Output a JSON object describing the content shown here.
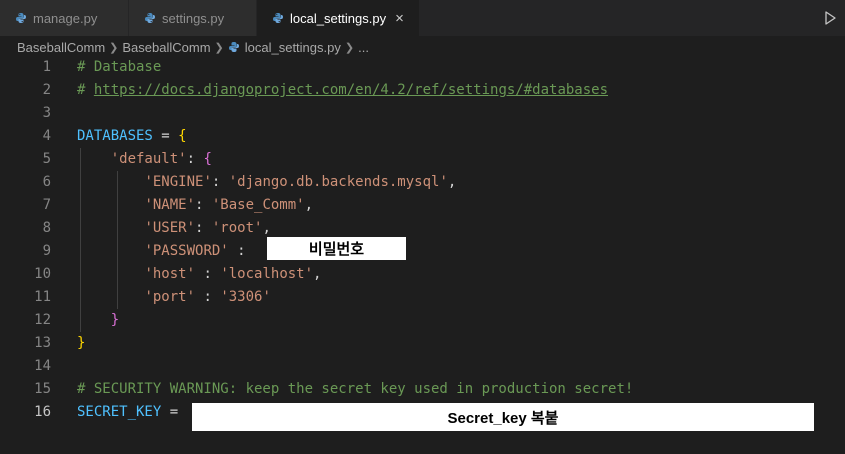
{
  "tabs": [
    {
      "label": "manage.py",
      "active": false
    },
    {
      "label": "settings.py",
      "active": false
    },
    {
      "label": "local_settings.py",
      "active": true
    }
  ],
  "tab_close_glyph": "×",
  "breadcrumb": {
    "items": [
      "BaseballComm",
      "BaseballComm",
      "local_settings.py",
      "..."
    ]
  },
  "code": {
    "line_numbers": [
      "1",
      "2",
      "3",
      "4",
      "5",
      "6",
      "7",
      "8",
      "9",
      "10",
      "11",
      "12",
      "13",
      "14",
      "15",
      "16"
    ],
    "comment_database": "# Database",
    "comment_prefix": "# ",
    "doc_link": "https://docs.djangoproject.com/en/4.2/ref/settings/#databases",
    "databases_var": "DATABASES",
    "assign": " = ",
    "open_brace": "{",
    "close_brace": "}",
    "default_key": "'default'",
    "colon": ": ",
    "spaced_colon": " : ",
    "comma": ",",
    "engine_key": "'ENGINE'",
    "engine_val": "'django.db.backends.mysql'",
    "name_key": "'NAME'",
    "name_val": "'Base_Comm'",
    "user_key": "'USER'",
    "user_val": "'root'",
    "password_key": "'PASSWORD'",
    "host_key": "'host'",
    "host_val": "'localhost'",
    "port_key": "'port'",
    "port_val": "'3306'",
    "security_comment": "# SECURITY WARNING: keep the secret key used in production secret!",
    "secret_key_var": "SECRET_KEY"
  },
  "redactions": {
    "password_label": "비밀번호",
    "secret_label": "Secret_key 복붙"
  },
  "colors": {
    "editor_bg": "#1e1e1e",
    "tabbar_bg": "#252526",
    "comment": "#6a9955",
    "string": "#ce9178",
    "variable": "#4fc1ff",
    "bracket_gold": "#ffd700",
    "bracket_purple": "#da70d6",
    "python_icon": "#4b8bbe"
  },
  "icons": {
    "file_type": "python-file-icon",
    "run": "run-triangle-icon"
  }
}
